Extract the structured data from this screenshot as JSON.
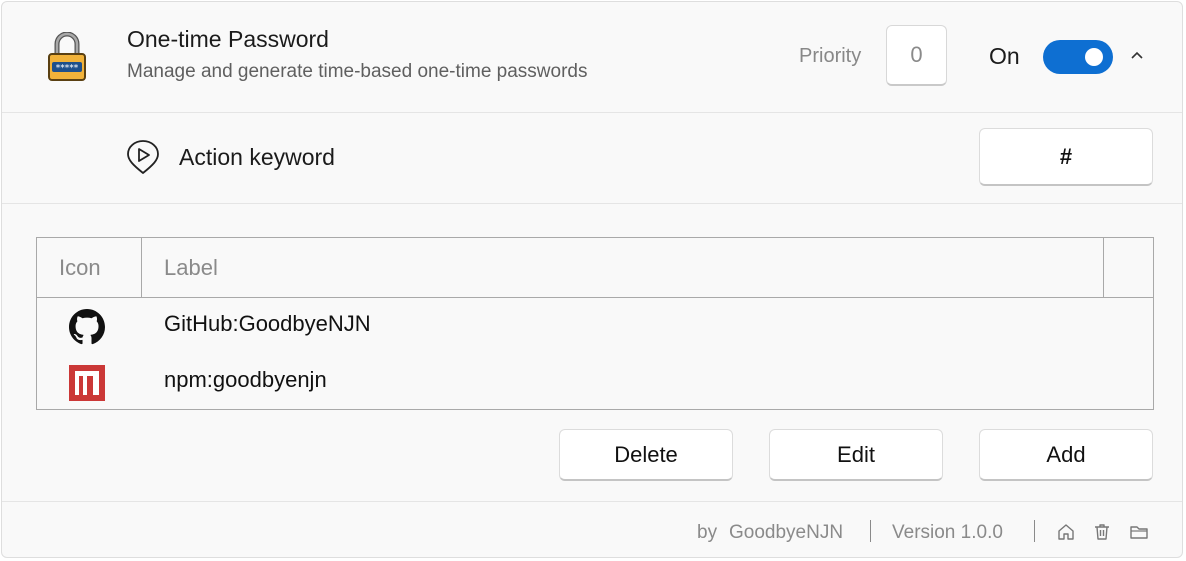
{
  "plugin": {
    "icon": "padlock-icon",
    "title": "One-time Password",
    "subtitle": "Manage and generate time-based one-time passwords",
    "priority_label": "Priority",
    "priority_value": "0",
    "enabled_label": "On",
    "enabled": true
  },
  "action_keyword": {
    "icon": "play-pin-icon",
    "label": "Action keyword",
    "value": "#"
  },
  "table": {
    "columns": [
      "Icon",
      "Label",
      ""
    ],
    "rows": [
      {
        "icon": "github-icon",
        "label": "GitHub:GoodbyeNJN"
      },
      {
        "icon": "npm-icon",
        "label": "npm:goodbyenjn"
      }
    ]
  },
  "buttons": {
    "delete": "Delete",
    "edit": "Edit",
    "add": "Add"
  },
  "footer": {
    "by": "by",
    "author": "GoodbyeNJN",
    "version": "Version 1.0.0",
    "icons": [
      "home-icon",
      "trash-icon",
      "folder-icon"
    ]
  },
  "colors": {
    "accent": "#0e6fd2",
    "npm": "#cb3837"
  }
}
